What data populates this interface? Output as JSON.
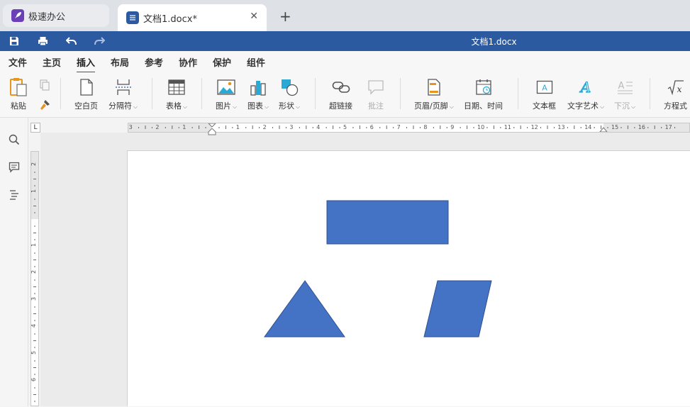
{
  "tabs": [
    {
      "label": "极速办公",
      "active": false
    },
    {
      "label": "文档1.docx*",
      "active": true
    }
  ],
  "title": "文档1.docx",
  "menu": [
    "文件",
    "主页",
    "插入",
    "布局",
    "参考",
    "协作",
    "保护",
    "组件"
  ],
  "active_menu": "插入",
  "ribbon": {
    "paste": "粘贴",
    "blank_page": "空白页",
    "separator": "分隔符",
    "table": "表格",
    "picture": "图片",
    "chart": "图表",
    "shape": "形状",
    "hyperlink": "超链接",
    "comment": "批注",
    "header_footer": "页眉/页脚",
    "date_time": "日期、时间",
    "textbox": "文本框",
    "wordart": "文字艺术",
    "dropcap": "下沉",
    "equation": "方程式"
  },
  "hruler_numbers": [
    "3",
    "2",
    "1",
    "1",
    "2",
    "3",
    "4",
    "5",
    "6",
    "7",
    "8",
    "9",
    "10",
    "11",
    "12",
    "13",
    "14",
    "15",
    "16",
    "17"
  ],
  "vruler_numbers": [
    "2",
    "1",
    "1",
    "2",
    "3",
    "4",
    "5",
    "6"
  ],
  "corner_label": "L",
  "colors": {
    "brand": "#2c5aa0",
    "shape_fill": "#4472c4",
    "shape_stroke": "#2f528f",
    "app_icon": "#6b3fb8"
  },
  "shapes": [
    "rectangle",
    "triangle",
    "parallelogram"
  ]
}
